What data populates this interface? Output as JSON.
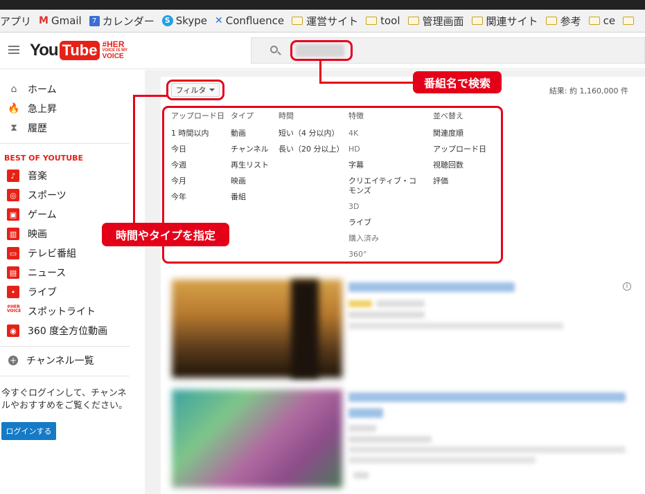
{
  "bookmarks": [
    {
      "label": "アプリ",
      "icon": "apps-icon"
    },
    {
      "label": "Gmail",
      "icon": "gmail-icon"
    },
    {
      "label": "カレンダー",
      "icon": "calendar-icon"
    },
    {
      "label": "Skype",
      "icon": "skype-icon"
    },
    {
      "label": "Confluence",
      "icon": "confluence-icon"
    },
    {
      "label": "運営サイト",
      "icon": "folder-icon"
    },
    {
      "label": "tool",
      "icon": "folder-icon"
    },
    {
      "label": "管理画面",
      "icon": "folder-icon"
    },
    {
      "label": "関連サイト",
      "icon": "folder-icon"
    },
    {
      "label": "参考",
      "icon": "folder-icon"
    },
    {
      "label": "ce",
      "icon": "folder-icon"
    }
  ],
  "masthead": {
    "logo_you": "You",
    "logo_tube": "Tube",
    "logo_her_l1": "#HER",
    "logo_her_l2": "VOICE IS MY",
    "logo_her_l3": "VOICE"
  },
  "sidebar": {
    "main_items": [
      {
        "label": "ホーム",
        "icon": "home-icon"
      },
      {
        "label": "急上昇",
        "icon": "flame-icon"
      },
      {
        "label": "履歴",
        "icon": "hourglass-icon"
      }
    ],
    "section_title": "BEST OF YOUTUBE",
    "categories": [
      {
        "label": "音楽",
        "icon": "music-icon"
      },
      {
        "label": "スポーツ",
        "icon": "sports-icon"
      },
      {
        "label": "ゲーム",
        "icon": "gamepad-icon"
      },
      {
        "label": "映画",
        "icon": "film-icon"
      },
      {
        "label": "テレビ番組",
        "icon": "tv-icon"
      },
      {
        "label": "ニュース",
        "icon": "news-icon"
      },
      {
        "label": "ライブ",
        "icon": "live-icon"
      },
      {
        "label": "スポットライト",
        "icon": "spotlight-icon"
      },
      {
        "label": "360 度全方位動画",
        "icon": "360-video-icon"
      }
    ],
    "channel_list": "チャンネル一覧",
    "login_prompt": "今すぐログインして、チャンネルやおすすめをご覧ください。",
    "login_button": "ログインする"
  },
  "search": {
    "placeholder": "",
    "value": ""
  },
  "filters": {
    "button_label": "フィルタ",
    "results": "結果: 約 1,160,000 件",
    "columns": [
      {
        "header": "アップロード日",
        "options": [
          "1 時間以内",
          "今日",
          "今週",
          "今月",
          "今年"
        ]
      },
      {
        "header": "タイプ",
        "options": [
          "動画",
          "チャンネル",
          "再生リスト",
          "映画",
          "番組"
        ]
      },
      {
        "header": "時間",
        "options": [
          "短い（4 分以内）",
          "長い（20 分以上）"
        ]
      },
      {
        "header": "特徴",
        "options": [
          "4K",
          "HD",
          "字幕",
          "クリエイティブ・コモンズ",
          "3D",
          "ライブ",
          "購入済み",
          "360°"
        ]
      },
      {
        "header": "並べ替え",
        "options": [
          "関連度順",
          "アップロード日",
          "視聴回数",
          "評価"
        ]
      }
    ]
  },
  "annotations": {
    "search_callout": "番組名で検索",
    "filter_callout": "時間やタイプを指定",
    "color": "#e5001a"
  },
  "colors": {
    "brand_red": "#e62117",
    "link_blue": "#167ac6"
  }
}
